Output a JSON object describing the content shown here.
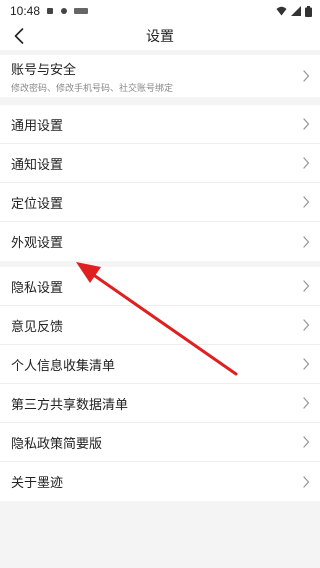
{
  "status_bar": {
    "time": "10:48"
  },
  "header": {
    "title": "设置"
  },
  "section_account": {
    "items": [
      {
        "label": "账号与安全",
        "subtitle": "修改密码、修改手机号码、社交账号绑定"
      }
    ]
  },
  "section_general": {
    "items": [
      {
        "label": "通用设置"
      },
      {
        "label": "通知设置"
      },
      {
        "label": "定位设置"
      },
      {
        "label": "外观设置"
      }
    ]
  },
  "section_privacy": {
    "items": [
      {
        "label": "隐私设置"
      },
      {
        "label": "意见反馈"
      },
      {
        "label": "个人信息收集清单"
      },
      {
        "label": "第三方共享数据清单"
      },
      {
        "label": "隐私政策简要版"
      },
      {
        "label": "关于墨迹"
      }
    ]
  },
  "colors": {
    "annotation_arrow": "#e02020"
  }
}
